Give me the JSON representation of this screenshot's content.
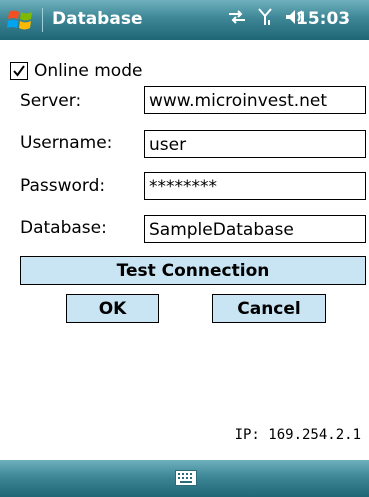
{
  "titlebar": {
    "title": "Database",
    "clock": "15:03"
  },
  "icons": {
    "start": "windows-flag-icon",
    "connectivity": "sync-arrows-icon",
    "signal": "signal-strength-icon",
    "volume": "speaker-icon",
    "keyboard": "keyboard-icon",
    "checkmark": "checkmark-icon"
  },
  "form": {
    "online_mode_label": "Online mode",
    "online_mode_checked": true,
    "server_label": "Server:",
    "server_value": "www.microinvest.net",
    "username_label": "Username:",
    "username_value": "user",
    "password_label": "Password:",
    "password_value": "********",
    "database_label": "Database:",
    "database_value": "SampleDatabase"
  },
  "buttons": {
    "test_connection": "Test Connection",
    "ok": "OK",
    "cancel": "Cancel"
  },
  "footer": {
    "ip": "IP: 169.254.2.1"
  },
  "colors": {
    "bar_top": "#6fb0bd",
    "bar_bottom": "#1f6575",
    "button_fill": "#c9e4f2"
  }
}
